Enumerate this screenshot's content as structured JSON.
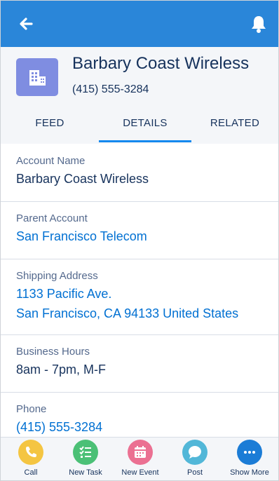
{
  "colors": {
    "brand": "#2a86d9",
    "link": "#0070d2",
    "text": "#16325c",
    "label": "#54698d"
  },
  "topbar": {
    "back_icon": "arrow-left-icon",
    "notification_icon": "bell-icon"
  },
  "record": {
    "icon": "building-icon",
    "name": "Barbary Coast Wireless",
    "phone": "(415) 555-3284"
  },
  "tabs": [
    {
      "label": "FEED"
    },
    {
      "label": "DETAILS",
      "active": true
    },
    {
      "label": "RELATED"
    }
  ],
  "fields": {
    "account_name": {
      "label": "Account Name",
      "value": "Barbary Coast Wireless"
    },
    "parent_account": {
      "label": "Parent Account",
      "value": "San Francisco Telecom"
    },
    "shipping_address": {
      "label": "Shipping Address",
      "line1": "1133 Pacific Ave.",
      "line2": "San Francisco, CA 94133 United States"
    },
    "business_hours": {
      "label": "Business Hours",
      "value": "8am - 7pm, M-F"
    },
    "phone": {
      "label": "Phone",
      "value": "(415) 555-3284"
    }
  },
  "actions": [
    {
      "label": "Call",
      "icon": "phone-icon",
      "color": "#f4c542"
    },
    {
      "label": "New Task",
      "icon": "checklist-icon",
      "color": "#4bc076"
    },
    {
      "label": "New Event",
      "icon": "calendar-icon",
      "color": "#eb7092"
    },
    {
      "label": "Post",
      "icon": "chat-bubble-icon",
      "color": "#52b7d8"
    },
    {
      "label": "Show More",
      "icon": "more-icon",
      "color": "#1b7cd6"
    }
  ]
}
